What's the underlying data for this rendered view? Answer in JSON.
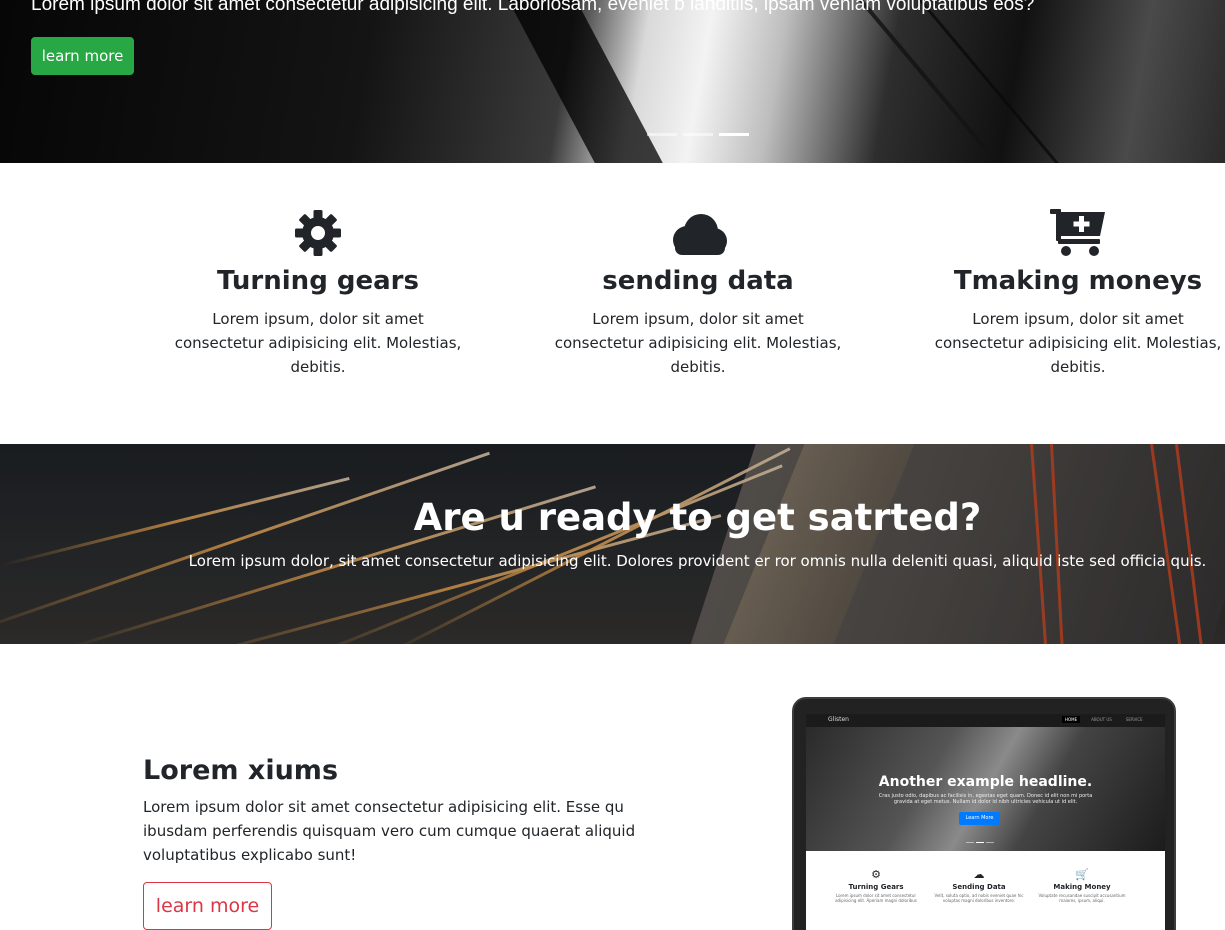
{
  "hero": {
    "text": "Lorem ipsum dolor sit amet consectetur adipisicing elit. Laboriosam, eveniet b landitiis, ipsam veniam voluptatibus eos?",
    "button_label": "learn more",
    "indicator_count": 3,
    "active_indicator": 3
  },
  "features": [
    {
      "icon": "gear-icon",
      "title": "Turning gears",
      "text": "Lorem ipsum, dolor sit amet consectetur adipisicing elit. Molestias, debitis."
    },
    {
      "icon": "cloud-icon",
      "title": "sending data",
      "text": "Lorem ipsum, dolor sit amet consectetur adipisicing elit. Molestias, debitis."
    },
    {
      "icon": "cart-plus-icon",
      "title": "Tmaking moneys",
      "text": "Lorem ipsum, dolor sit amet consectetur adipisicing elit. Molestias, debitis."
    }
  ],
  "banner": {
    "title": "Are u ready to get satrted?",
    "text": "Lorem ipsum dolor, sit amet consectetur adipisicing elit. Dolores provident er ror omnis nulla deleniti quasi, aliquid iste sed officia quis."
  },
  "about": {
    "title": "Lorem xiums",
    "text": "Lorem ipsum dolor sit amet consectetur adipisicing elit. Esse qu ibusdam perferendis quisquam vero cum cumque quaerat aliquid voluptatibus explicabo sunt!",
    "button_label": "learn more"
  },
  "laptop_screen": {
    "brand": "Glisten",
    "nav": [
      "HOME",
      "ABOUT US",
      "SERVICE"
    ],
    "headline": "Another example headline.",
    "hero_text": "Cras justo odio, dapibus ac facilisis in, egestas eget quam. Donec id elit non mi porta gravida at eget metus. Nullam id dolor id nibh ultricies vehicula ut id elit.",
    "button_label": "Learn More",
    "features": [
      {
        "title": "Turning Gears",
        "text": "Lorem ipsum dolor sit amet consectetur adipisicing elit. Aperiam magni doloribus"
      },
      {
        "title": "Sending Data",
        "text": "Velit, soluta optio, ad nobis eveniet quae hic voluptas magni doloribus inventore."
      },
      {
        "title": "Making Money",
        "text": "Voluptate recusandae suscipit accusantium maiores, ipsum, aliqui."
      }
    ]
  },
  "colors": {
    "success_green": "#28a745",
    "danger_red": "#dc3545",
    "primary_blue": "#007bff",
    "text_dark": "#212529"
  }
}
